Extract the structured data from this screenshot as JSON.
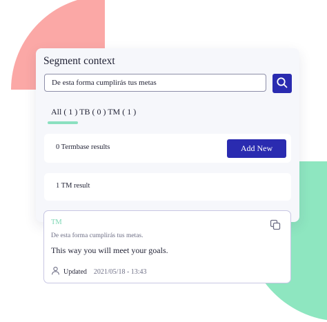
{
  "panel": {
    "title": "Segment context",
    "search": {
      "value": "De esta forma cumplirás tus metas"
    },
    "tabs": {
      "label": "All ( 1 ) TB ( 0 ) TM ( 1 )"
    },
    "termbase": {
      "results_label": "0 Termbase results",
      "add_button_label": "Add New"
    },
    "tm": {
      "results_label": "1 TM result"
    }
  },
  "tm_card": {
    "label": "TM",
    "source": "De esta forma cumplirás tus metas.",
    "target": "This way you will meet your goals.",
    "updated_label": "Updated",
    "updated_date": "2021/05/18 - 13:43"
  },
  "icons": [
    "search-icon",
    "copy-icon",
    "user-icon"
  ],
  "colors": {
    "accent": "#2a2bb0",
    "tm_green": "#7dd7b4",
    "deco_pink": "#fba8a6",
    "deco_green": "#8ee6c0",
    "card_border": "#c7c6e3"
  }
}
